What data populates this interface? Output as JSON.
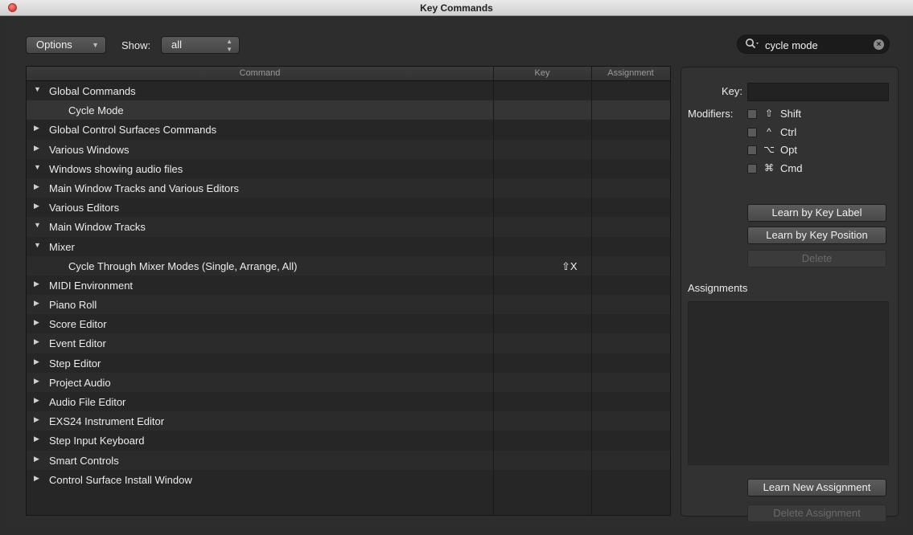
{
  "window": {
    "title": "Key Commands"
  },
  "toolbar": {
    "options_label": "Options",
    "show_label": "Show:",
    "show_value": "all"
  },
  "search": {
    "value": "cycle mode"
  },
  "table": {
    "columns": [
      "Command",
      "Key",
      "Assignment"
    ],
    "rows": [
      {
        "label": "Global Commands",
        "expanded": true,
        "level": 0,
        "key": ""
      },
      {
        "label": "Cycle Mode",
        "expanded": null,
        "level": 1,
        "key": "",
        "selected": true
      },
      {
        "label": "Global Control Surfaces Commands",
        "expanded": false,
        "level": 0,
        "key": ""
      },
      {
        "label": "Various Windows",
        "expanded": false,
        "level": 0,
        "key": ""
      },
      {
        "label": "Windows showing audio files",
        "expanded": true,
        "level": 0,
        "key": ""
      },
      {
        "label": "Main Window Tracks and Various Editors",
        "expanded": false,
        "level": 0,
        "key": ""
      },
      {
        "label": "Various Editors",
        "expanded": false,
        "level": 0,
        "key": ""
      },
      {
        "label": "Main Window Tracks",
        "expanded": true,
        "level": 0,
        "key": ""
      },
      {
        "label": "Mixer",
        "expanded": true,
        "level": 0,
        "key": ""
      },
      {
        "label": "Cycle Through Mixer Modes (Single, Arrange, All)",
        "expanded": null,
        "level": 1,
        "key": "⇧X"
      },
      {
        "label": "MIDI Environment",
        "expanded": false,
        "level": 0,
        "key": ""
      },
      {
        "label": "Piano Roll",
        "expanded": false,
        "level": 0,
        "key": ""
      },
      {
        "label": "Score Editor",
        "expanded": false,
        "level": 0,
        "key": ""
      },
      {
        "label": "Event Editor",
        "expanded": false,
        "level": 0,
        "key": ""
      },
      {
        "label": "Step Editor",
        "expanded": false,
        "level": 0,
        "key": ""
      },
      {
        "label": "Project Audio",
        "expanded": false,
        "level": 0,
        "key": ""
      },
      {
        "label": "Audio File Editor",
        "expanded": false,
        "level": 0,
        "key": ""
      },
      {
        "label": "EXS24 Instrument Editor",
        "expanded": false,
        "level": 0,
        "key": ""
      },
      {
        "label": "Step Input Keyboard",
        "expanded": false,
        "level": 0,
        "key": ""
      },
      {
        "label": "Smart Controls",
        "expanded": false,
        "level": 0,
        "key": ""
      },
      {
        "label": "Control Surface Install Window",
        "expanded": false,
        "level": 0,
        "key": ""
      }
    ]
  },
  "panel": {
    "key_label": "Key:",
    "modifiers_label": "Modifiers:",
    "modifiers": [
      {
        "symbol": "⇧",
        "label": "Shift"
      },
      {
        "symbol": "^",
        "label": "Ctrl"
      },
      {
        "symbol": "⌥",
        "label": "Opt"
      },
      {
        "symbol": "⌘",
        "label": "Cmd"
      }
    ],
    "learn_by_label": "Learn by Key Label",
    "learn_by_position": "Learn by Key Position",
    "delete_label": "Delete",
    "assignments_label": "Assignments",
    "learn_new_assignment": "Learn New Assignment",
    "delete_assignment": "Delete Assignment"
  },
  "icons": {
    "close": "close-icon",
    "search": "search-icon",
    "clear": "clear-search-icon",
    "expanded": "disclosure-down-icon",
    "collapsed": "disclosure-right-icon"
  }
}
